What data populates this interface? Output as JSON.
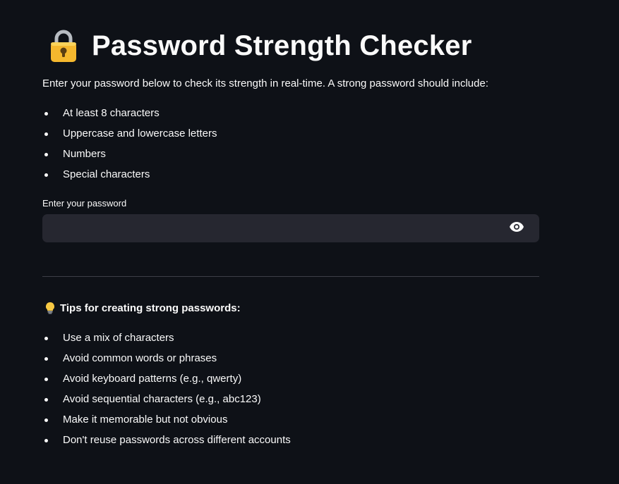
{
  "header": {
    "icon": "lock-icon",
    "title": "Password Strength Checker"
  },
  "intro": {
    "text": "Enter your password below to check its strength in real-time. A strong password should include:"
  },
  "requirements": {
    "items": [
      "At least 8 characters",
      "Uppercase and lowercase letters",
      "Numbers",
      "Special characters"
    ]
  },
  "password_field": {
    "label": "Enter your password",
    "value": "",
    "placeholder": "",
    "toggle_icon": "eye-icon"
  },
  "tips": {
    "icon": "lightbulb-icon",
    "heading": "Tips for creating strong passwords:",
    "items": [
      "Use a mix of characters",
      "Avoid common words or phrases",
      "Avoid keyboard patterns (e.g., qwerty)",
      "Avoid sequential characters (e.g., abc123)",
      "Make it memorable but not obvious",
      "Don't reuse passwords across different accounts"
    ]
  },
  "colors": {
    "background": "#0e1117",
    "text": "#fafafa",
    "input_background": "#262730",
    "divider": "#3d3f47",
    "lock_gold": "#f5b82e"
  }
}
